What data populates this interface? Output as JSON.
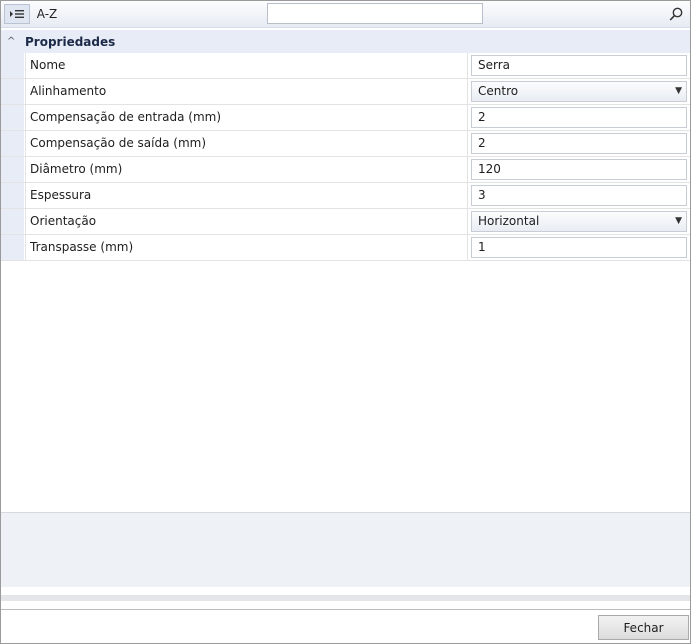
{
  "toolbar": {
    "categorized_icon": "categorized-view-icon",
    "sort_label": "A-Z",
    "search_value": "",
    "search_icon": "search-icon"
  },
  "category": {
    "title": "Propriedades",
    "expanded": true
  },
  "properties": [
    {
      "name": "Nome",
      "value": "Serra",
      "type": "text"
    },
    {
      "name": "Alinhamento",
      "value": "Centro",
      "type": "select"
    },
    {
      "name": "Compensação de entrada (mm)",
      "value": "2",
      "type": "text"
    },
    {
      "name": "Compensação de saída (mm)",
      "value": "2",
      "type": "text"
    },
    {
      "name": "Diâmetro (mm)",
      "value": "120",
      "type": "text"
    },
    {
      "name": "Espessura",
      "value": "3",
      "type": "text"
    },
    {
      "name": "Orientação",
      "value": "Horizontal",
      "type": "select"
    },
    {
      "name": "Transpasse (mm)",
      "value": "1",
      "type": "text"
    }
  ],
  "footer": {
    "close_label": "Fechar"
  }
}
